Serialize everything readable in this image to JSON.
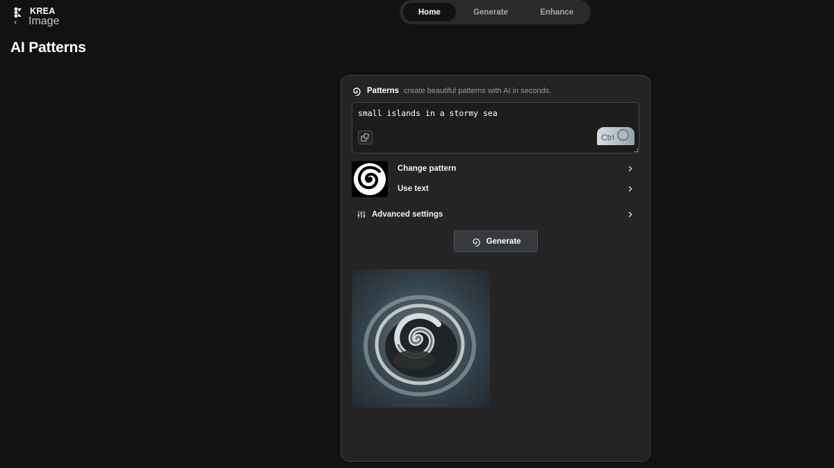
{
  "brand": {
    "name": "KREA",
    "product": "Image",
    "back_glyph": "‹"
  },
  "page": {
    "title": "AI Patterns"
  },
  "nav": {
    "tabs": [
      {
        "label": "Home",
        "active": true
      },
      {
        "label": "Generate",
        "active": false
      },
      {
        "label": "Enhance",
        "active": false
      }
    ]
  },
  "panel": {
    "heading": "Patterns",
    "description": "create beautiful patterns with AI in seconds.",
    "prompt_value": "small islands in a stormy sea",
    "shortcut_label": "Ctrl",
    "options": {
      "change_pattern": "Change pattern",
      "use_text": "Use text",
      "advanced_settings": "Advanced settings"
    },
    "generate_label": "Generate"
  },
  "icons": {
    "logo": "krea-logo-icon",
    "back": "chevron-left-icon",
    "patterns": "spiral-icon",
    "dice": "dice-icon",
    "chevron": "chevron-right-icon",
    "sliders": "sliders-icon"
  },
  "colors": {
    "background": "#121212",
    "panel": "#242424",
    "nav": "#2a2a2a",
    "button": "#363a3e",
    "ocean": "#3a4346"
  }
}
